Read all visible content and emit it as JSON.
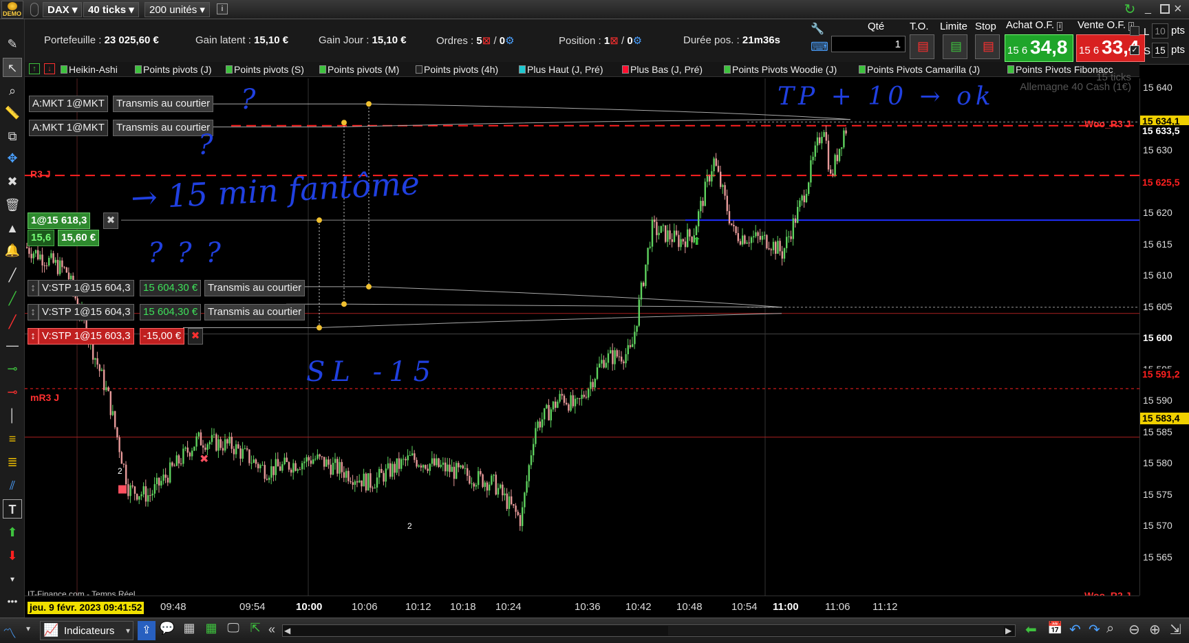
{
  "titlebar": {
    "badge": "DEMO",
    "instrument": "DAX",
    "ticks": "40 ticks",
    "units": "200 unités",
    "info_glyph": "i"
  },
  "infobar": {
    "portefeuille_label": "Portefeuille :",
    "portefeuille_value": "23 025,60 €",
    "gain_latent_label": "Gain latent :",
    "gain_latent_value": "15,10 €",
    "gain_jour_label": "Gain Jour :",
    "gain_jour_value": "15,10 €",
    "ordres_label": "Ordres :",
    "ordres_a": "5",
    "ordres_sep": "/",
    "ordres_b": "0",
    "position_label": "Position :",
    "position_a": "1",
    "position_sep": "/",
    "position_b": "0",
    "duree_label": "Durée pos. :",
    "duree_value": "21m36s"
  },
  "tradepanel": {
    "qte_label": "Qté",
    "qte_value": "1",
    "to_label": "T.O.",
    "limite_label": "Limite",
    "stop_label": "Stop",
    "achat_label": "Achat O.F.",
    "achat_small": "15 6",
    "achat_big": "34,8",
    "vente_label": "Vente O.F.",
    "vente_small": "15 6",
    "vente_big": "33,4",
    "l_label": "L",
    "l_value": "10",
    "s_label": "S",
    "s_value": "15",
    "pts": "pts"
  },
  "indicators": [
    {
      "label": "Heikin-Ashi",
      "color": "#3ec23e"
    },
    {
      "label": "Points pivots (J)",
      "color": "#3ec23e"
    },
    {
      "label": "Points pivots (S)",
      "color": "#3ec23e"
    },
    {
      "label": "Points pivots (M)",
      "color": "#3ec23e"
    },
    {
      "label": "Points pivots (4h)",
      "color": "#222222"
    },
    {
      "label": "Plus Haut (J, Pré)",
      "color": "#20c8d0"
    },
    {
      "label": "Plus Bas (J, Pré)",
      "color": "#ff1030"
    },
    {
      "label": "Points Pivots Woodie (J)",
      "color": "#3ec23e"
    },
    {
      "label": "Points Pivots Camarilla (J)",
      "color": "#3ec23e"
    },
    {
      "label": "Points Pivots Fibonacc",
      "color": "#3ec23e"
    }
  ],
  "chart_overlay": {
    "watermark_1": "15 ticks",
    "watermark_2": "Allemagne 40 Cash (1€)",
    "source": "IT-Finance.com - Temps Réel",
    "r3": "R3 J",
    "mr3": "mR3 J",
    "woo_r3": "Woo_R3 J",
    "woo_r2": "Woo_R2 J",
    "marker_2": "2"
  },
  "orders": {
    "mkt1_label": "A:MKT 1@MKT",
    "mkt1_status": "Transmis au courtier",
    "mkt2_label": "A:MKT 1@MKT",
    "mkt2_status": "Transmis au courtier",
    "pos_label": "1@15 618,3",
    "pos_gain_a": "15,6",
    "pos_gain_b": "15,60 €",
    "stp1_label": "V:STP 1@15 604,3",
    "stp1_value": "15 604,30 €",
    "stp1_status": "Transmis au courtier",
    "stp2_label": "V:STP 1@15 604,3",
    "stp2_value": "15 604,30 €",
    "stp2_status": "Transmis au courtier",
    "stp3_label": "V:STP 1@15 603,3",
    "stp3_value": "-15,00 €"
  },
  "annotations": {
    "q1": "?",
    "q2": "?",
    "q3": "? ? ?",
    "fantome": "→ 15 min fantôme",
    "sl": "SL -15",
    "tp": "TP + 10 → ok"
  },
  "yaxis": {
    "labels": [
      "15 640",
      "15 635",
      "15 630",
      "15 625",
      "15 620",
      "15 615",
      "15 610",
      "15 605",
      "15 600",
      "15 595",
      "15 590",
      "15 585",
      "15 580",
      "15 575",
      "15 570",
      "15 565"
    ],
    "tags": [
      {
        "value": "15 634,1",
        "color": "#f0d000"
      },
      {
        "value": "15 633,5",
        "color": "#ffffff"
      },
      {
        "value": "15 625,5",
        "color": "#ff2020"
      },
      {
        "value": "15 591,2",
        "color": "#ff2020"
      },
      {
        "value": "15 583,4",
        "color": "#f0d000"
      }
    ]
  },
  "xaxis": {
    "date": "jeu. 9 févr. 2023 09:41:52",
    "labels": [
      "09:48",
      "09:54",
      "10:00",
      "10:06",
      "10:12",
      "10:18",
      "10:24",
      "10:36",
      "10:42",
      "10:48",
      "10:54",
      "11:00",
      "11:06",
      "11:12"
    ]
  },
  "bottombar": {
    "indicateurs": "Indicateurs"
  }
}
